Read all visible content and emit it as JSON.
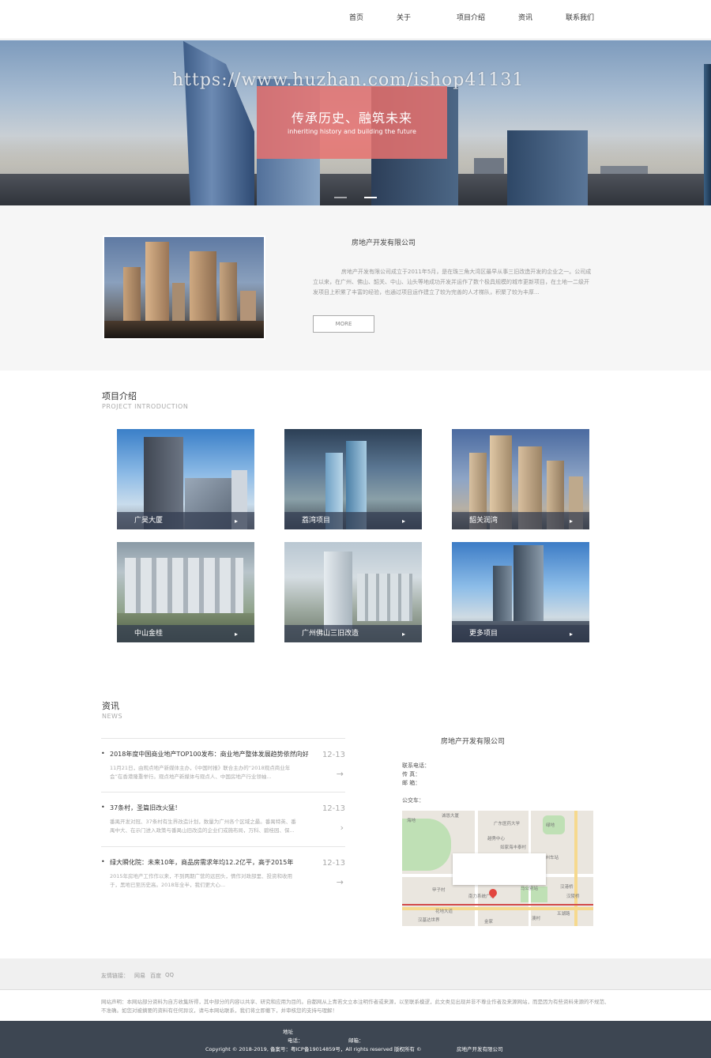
{
  "nav": {
    "items": [
      "首页",
      "关于",
      "项目介绍",
      "资讯",
      "联系我们"
    ]
  },
  "hero": {
    "title": "传承历史、融筑未来",
    "subtitle": "inheriting history and building the future",
    "watermark": "https://www.huzhan.com/ishop41131",
    "slides": 2,
    "active_slide": 2
  },
  "about": {
    "title": "房地产开发有限公司",
    "desc": "房地产开发有限公司成立于2011年5月，是在珠三角大湾区最早从事三旧改造开发的企业之一。公司成立以来，在广州、佛山、韶关、中山、汕头等地成功开发并运作了数个极具规模的城市更新项目，在土地一二级开发项目上积累了丰富的经验，也通过项目运作建立了较为完善的人才梯队，积聚了较为丰厚...",
    "more": "MORE"
  },
  "projects": {
    "title": "项目介绍",
    "subtitle": "PROJECT INTRODUCTION",
    "items": [
      {
        "label": "广昊大厦"
      },
      {
        "label": "荔湾项目"
      },
      {
        "label": "韶关润湾"
      },
      {
        "label": "中山金桂"
      },
      {
        "label": "广州佛山三旧改造"
      },
      {
        "label": "更多项目"
      }
    ],
    "arrow": "▸"
  },
  "news": {
    "title": "资讯",
    "subtitle": "NEWS",
    "items": [
      {
        "title": "2018年度中国商业地产TOP100发布：商业地产整体发展趋势依然向好",
        "summary": "11月21日，由观点地产新媒体主办，《中国时报》联合主办的“2018观点商业年会”在香港隆重举行。观点地产新媒体与观点人、中国房地产行业领袖...",
        "date": "12-13"
      },
      {
        "title": "37条村，圣篇旧改火猛！",
        "summary": "番禺开发对冠、37条村有生界改造计划，数量为广州各个区域之最。番禺特英、番禺中大、在示门进入政策与番禺山旧改造的企业们或施布局，万科、碧桂园、保...",
        "date": "12-13"
      },
      {
        "title": "绿大瞬化院：未来10年，商品房需求年均12.2亿平，高于2015年",
        "summary": "2015年房地产工作作以来，不到两期广营的远回头，情作对政部里、投资和收用于，黑地已至历史高。2018年全半，我们更大心...",
        "date": "12-13"
      }
    ],
    "arrow": "→",
    "arrow_alt": "›"
  },
  "contact": {
    "title": "房地产开发有限公司",
    "phone_label": "联系电话：",
    "fax_label": "传  真：",
    "email_label": "邮  箱：",
    "bus_label": "公交车：",
    "map_labels": [
      "诚恳大厦",
      "海地",
      "广东医药大学",
      "越秀中心",
      "如家海丰泰村",
      "广州车站",
      "马公别站",
      "汉港桥",
      "甲子村",
      "南力系统广场",
      "花地大道",
      "汉陵桥",
      "澳村",
      "汉基达世界",
      "金家",
      "五湖路",
      "绿地"
    ]
  },
  "links": {
    "label": "友情链接：",
    "items": [
      "网易",
      "百度",
      "QQ"
    ]
  },
  "disclaimer": "网站声明：本网站部分资料为自方收集所得，其中部分的内容以共享、研究和应用为目的。自都网从上青若文立本注明作者或来源，以至联系模逻，此文类见出现并非不尊业作者及来源网站，而是因为有些资料来源的不规范、不准确。如您对被摘要的资料有任何异议，请与本网站联系，我们将立即撤下，并审核您的支持与理解！",
  "footer": {
    "address_label": "地址",
    "phone_label": "电话：",
    "email_label": "邮箱：",
    "copyright": "Copyright © 2018-2019, 备案号：粤ICP备19014859号，All rights reserved 版权所有 ©",
    "company": "房地产开发有限公司"
  },
  "colors": {
    "banner": "#e8726e",
    "footer": "#3d4652",
    "accent_bar": "#323c50"
  }
}
